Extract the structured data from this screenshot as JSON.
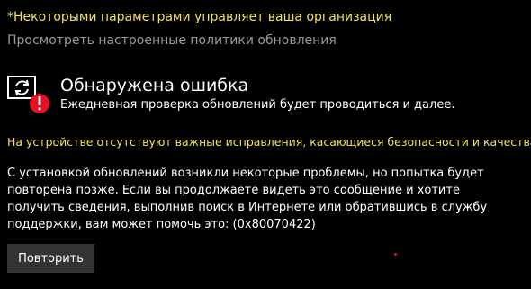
{
  "org_notice": "*Некоторыми параметрами управляет ваша организация",
  "policies_link": "Просмотреть настроенные политики обновления",
  "status": {
    "icon": "update-sync-error-icon",
    "title": "Обнаружена ошибка",
    "description": "Ежедневная проверка обновлений будет проводиться и далее."
  },
  "security_warning": "На устройстве отсутствуют важные исправления, касающиеся безопасности и качества.",
  "error_details": "С установкой обновлений возникли некоторые проблемы, но попытка будет повторена позже. Если вы продолжаете видеть это сообщение и хотите получить сведения, выполнив поиск в Интернете или обратившись в службу поддержки, вам может помочь это: (0x80070422)",
  "retry_button": "Повторить",
  "colors": {
    "background": "#000000",
    "warning_text": "#f3e05a",
    "link_text": "#9a9a9a",
    "error_badge": "#e81123",
    "button_bg": "#333333"
  }
}
